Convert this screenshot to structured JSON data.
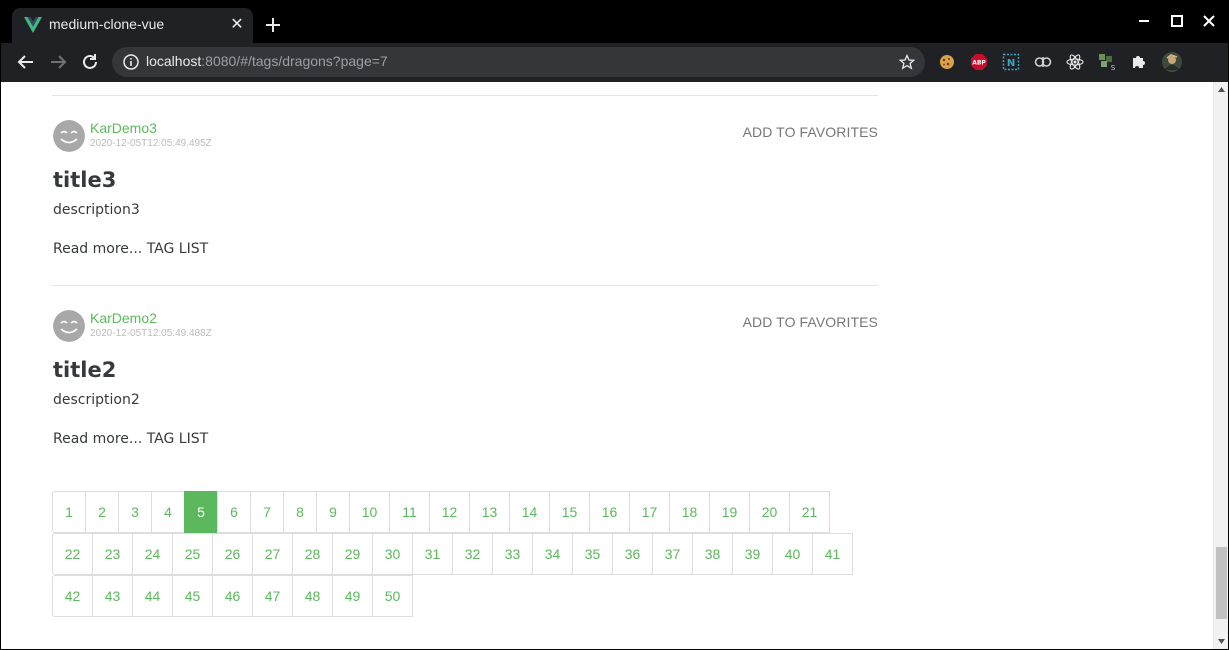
{
  "browser": {
    "tab_title": "medium-clone-vue",
    "url_host": "localhost",
    "url_rest": ":8080/#/tags/dragons?page=7",
    "extensions": [
      "cookie-icon",
      "adblock-icon",
      "notion-icon",
      "butterfly-icon",
      "react-icon",
      "extension-s-icon",
      "puzzle-icon",
      "profile-avatar"
    ],
    "abp_label": "ABP",
    "notion_label": "N"
  },
  "articles": [
    {
      "author": "KarDemo3",
      "date": "2020-12-05T12:05:49.495Z",
      "favorite_label": "ADD TO FAVORITES",
      "title": "title3",
      "description": "description3",
      "read_more": "Read more...",
      "tag_list": "TAG LIST"
    },
    {
      "author": "KarDemo2",
      "date": "2020-12-05T12:05:49.488Z",
      "favorite_label": "ADD TO FAVORITES",
      "title": "title2",
      "description": "description2",
      "read_more": "Read more...",
      "tag_list": "TAG LIST"
    }
  ],
  "pagination": {
    "active": 5,
    "rows": [
      [
        "1",
        "2",
        "3",
        "4",
        "5",
        "6",
        "7",
        "8",
        "9",
        "10",
        "11",
        "12",
        "13",
        "14",
        "15",
        "16",
        "17",
        "18",
        "19",
        "20",
        "21"
      ],
      [
        "22",
        "23",
        "24",
        "25",
        "26",
        "27",
        "28",
        "29",
        "30",
        "31",
        "32",
        "33",
        "34",
        "35",
        "36",
        "37",
        "38",
        "39",
        "40",
        "41"
      ],
      [
        "42",
        "43",
        "44",
        "45",
        "46",
        "47",
        "48",
        "49",
        "50"
      ]
    ]
  },
  "colors": {
    "accent": "#5cb85c",
    "text": "#373a3c",
    "muted": "#777777"
  }
}
